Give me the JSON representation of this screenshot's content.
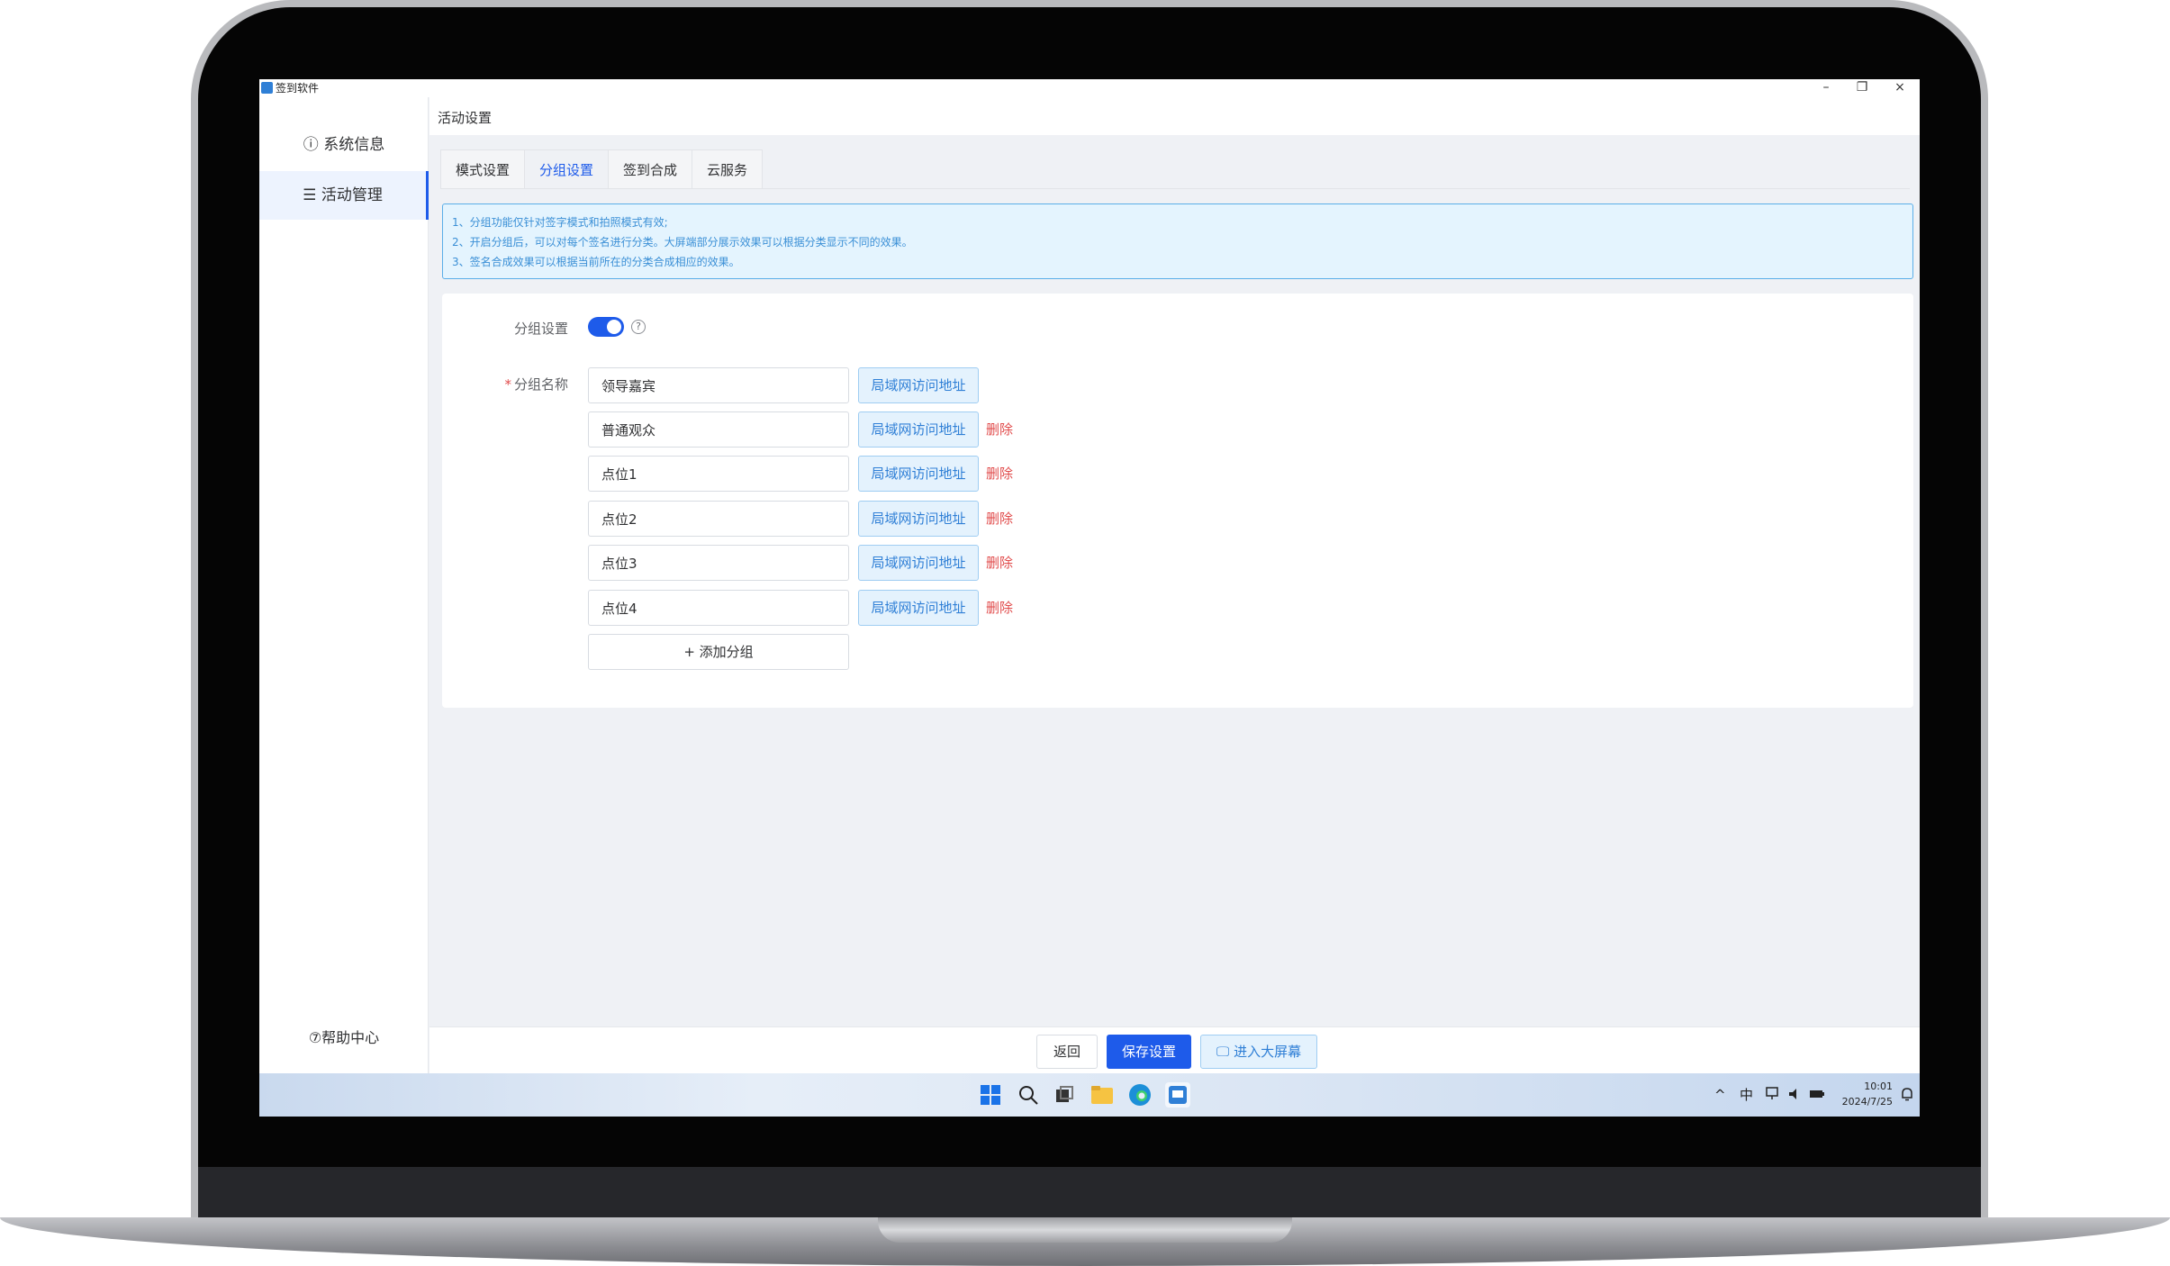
{
  "window": {
    "title": "签到软件",
    "minimize": "–",
    "restore": "❐",
    "close": "×"
  },
  "sidebar": {
    "items": [
      {
        "icon": "ⓘ",
        "label": "系统信息"
      },
      {
        "icon": "☰",
        "label": "活动管理"
      }
    ],
    "help": {
      "icon": "⑦",
      "label": "帮助中心"
    }
  },
  "breadcrumb": "活动设置",
  "tabs": [
    "模式设置",
    "分组设置",
    "签到合成",
    "云服务"
  ],
  "active_tab": "分组设置",
  "notice": [
    "1、分组功能仅针对签字模式和拍照模式有效;",
    "2、开启分组后，可以对每个签名进行分类。大屏端部分展示效果可以根据分类显示不同的效果。",
    "3、签名合成效果可以根据当前所在的分类合成相应的效果。"
  ],
  "form": {
    "group_setting_label": "分组设置",
    "group_enabled": true,
    "help_icon": "?",
    "group_name_label": "分组名称",
    "required_mark": "*",
    "lan_button_label": "局域网访问地址",
    "delete_label": "删除",
    "groups": [
      "领导嘉宾",
      "普通观众",
      "点位1",
      "点位2",
      "点位3",
      "点位4"
    ],
    "add_group_label": "+ 添加分组"
  },
  "footer": {
    "back_label": "返回",
    "save_label": "保存设置",
    "screen_label": "进入大屏幕",
    "screen_icon": "🖵"
  },
  "taskbar": {
    "ime": "中",
    "time": "10:01",
    "date": "2024/7/25"
  }
}
